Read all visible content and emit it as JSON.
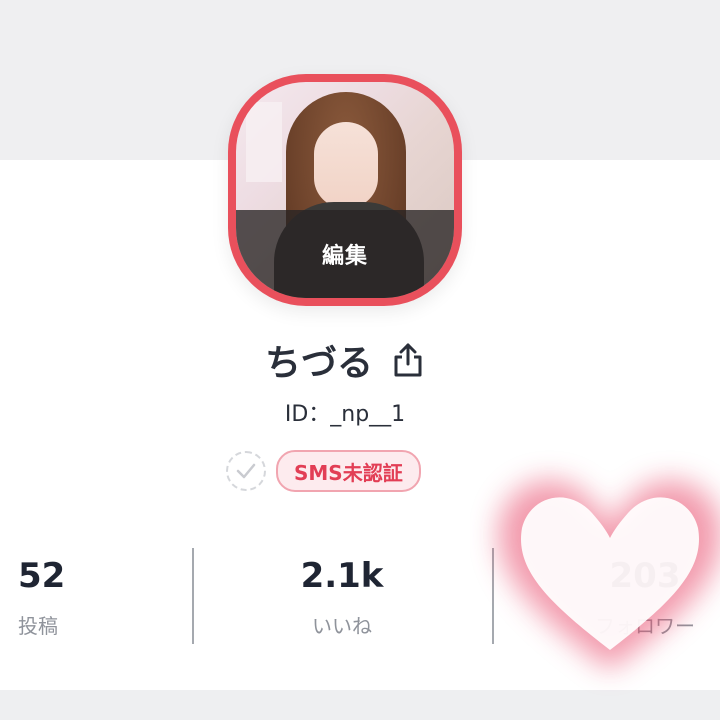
{
  "profile": {
    "edit_label": "編集",
    "name": "ちづる",
    "user_id": "ID：_np__1",
    "sms_status": "SMS未認証"
  },
  "stats": [
    {
      "value": "52",
      "label": "投稿"
    },
    {
      "value": "2.1k",
      "label": "いいね"
    },
    {
      "value": "203",
      "label": "フォロワー"
    }
  ],
  "icons": {
    "share": "share-icon",
    "verify": "check-circle-icon",
    "heart": "heart-icon"
  },
  "colors": {
    "avatar_border": "#e9505c",
    "badge_text": "#e23e55",
    "badge_bg": "#fdebee"
  }
}
